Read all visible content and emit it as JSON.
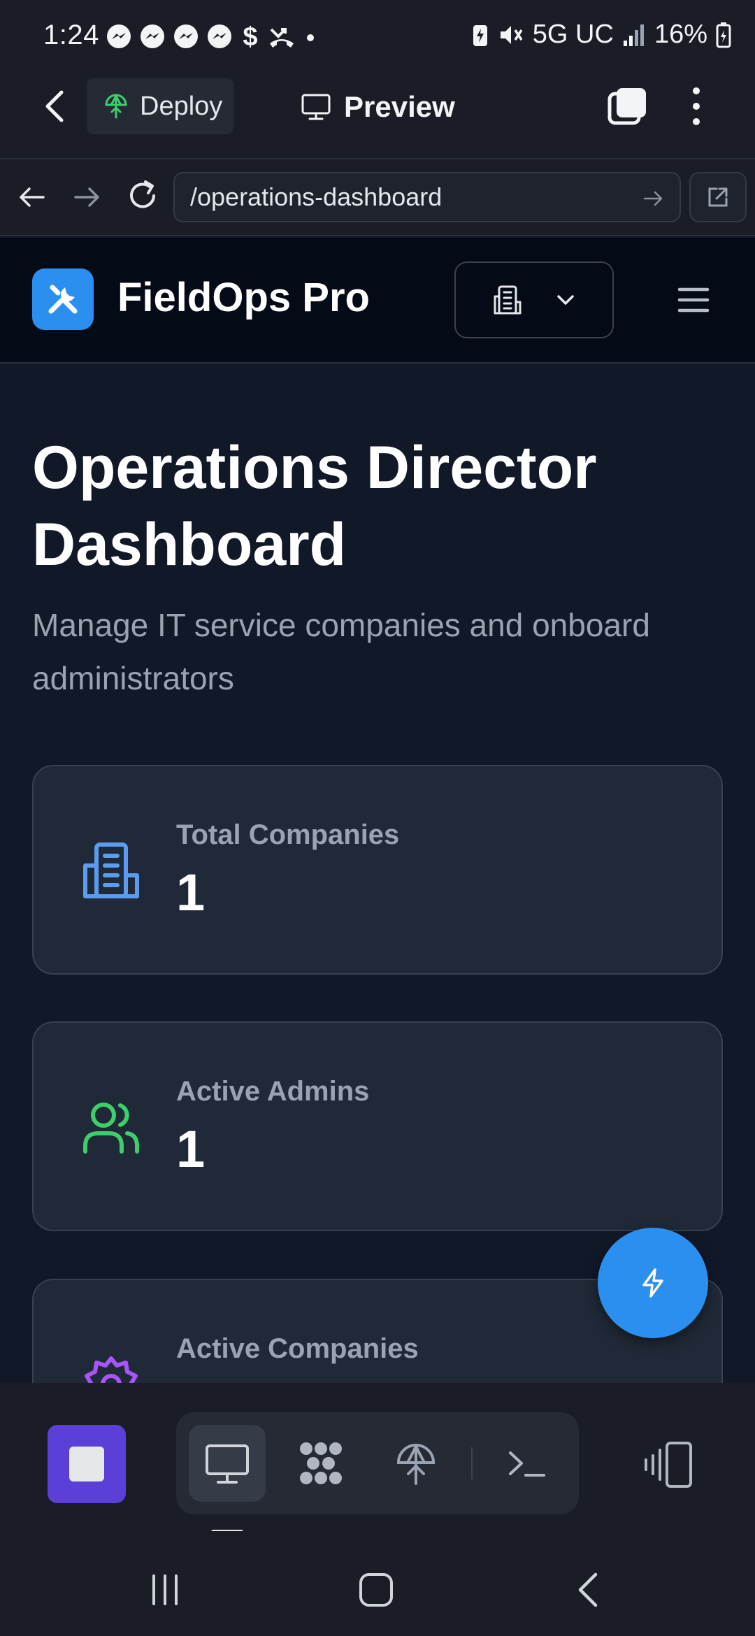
{
  "status_bar": {
    "time": "1:24",
    "network": "5G UC",
    "battery": "16%",
    "icons": [
      "messenger-icon",
      "messenger-icon",
      "messenger-icon",
      "messenger-icon",
      "dollar-icon",
      "missed-call-icon",
      "dot-icon",
      "battery-saver-icon",
      "mute-icon",
      "signal-icon",
      "battery-icon"
    ]
  },
  "chrome": {
    "deploy_label": "Deploy",
    "preview_label": "Preview",
    "url": "/operations-dashboard"
  },
  "app": {
    "name": "FieldOps Pro",
    "brand_color": "#2b8ff0"
  },
  "main": {
    "title": "Operations Director Dashboard",
    "subtitle": "Manage IT service companies and onboard administrators"
  },
  "stats": [
    {
      "label": "Total Companies",
      "value": "1",
      "icon": "building-icon",
      "color": "#5b9cf0"
    },
    {
      "label": "Active Admins",
      "value": "1",
      "icon": "users-icon",
      "color": "#3ecf6b"
    },
    {
      "label": "Active Companies",
      "value": "",
      "icon": "settings-cog-icon",
      "color": "#a855f7"
    }
  ],
  "toolbar": {
    "tools": [
      "desktop-icon",
      "apps-grid-icon",
      "deploy-icon",
      "terminal-icon"
    ]
  }
}
